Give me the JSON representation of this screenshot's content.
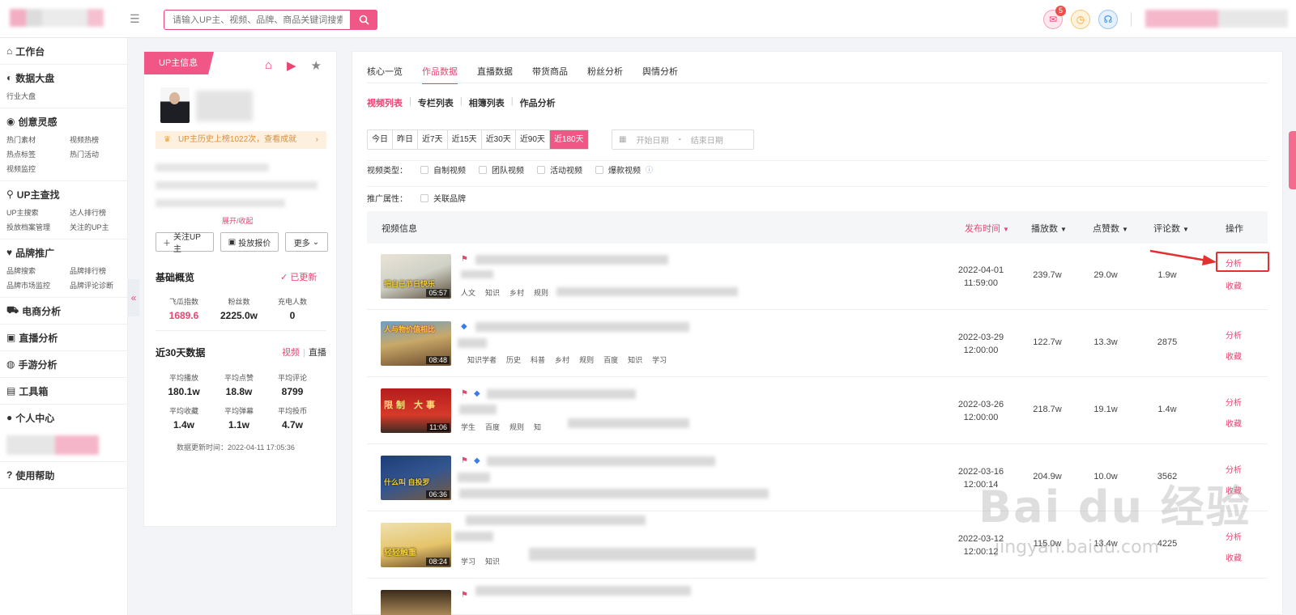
{
  "search": {
    "placeholder": "请输入UP主、视频、品牌、商品关键词搜索"
  },
  "notifications": {
    "mail_count": "5"
  },
  "sidebar": {
    "sections": [
      {
        "title": "工作台",
        "items": []
      },
      {
        "title": "数据大盘",
        "items": [
          "行业大盘"
        ]
      },
      {
        "title": "创意灵感",
        "items": [
          "热门素材",
          "视频热榜",
          "热点标签",
          "热门活动",
          "视频监控"
        ]
      },
      {
        "title": "UP主查找",
        "items": [
          "UP主搜索",
          "达人排行榜",
          "投放档案管理",
          "关注的UP主"
        ]
      },
      {
        "title": "品牌推广",
        "items": [
          "品牌搜索",
          "品牌排行榜",
          "品牌市场监控",
          "品牌评论诊断"
        ]
      },
      {
        "title": "电商分析",
        "items": []
      },
      {
        "title": "直播分析",
        "items": []
      },
      {
        "title": "手游分析",
        "items": []
      },
      {
        "title": "工具箱",
        "items": []
      },
      {
        "title": "个人中心",
        "items": []
      },
      {
        "title": "使用帮助",
        "items": []
      }
    ]
  },
  "up_panel": {
    "tag": "UP主信息",
    "notice": "UP主历史上榜1022次，查看成就",
    "expand": "展开/收起",
    "buttons": {
      "follow": "关注UP主",
      "quote": "投放报价",
      "more": "更多"
    },
    "overview_title": "基础概览",
    "updated": "已更新",
    "overview": [
      {
        "label": "飞瓜指数",
        "value": "1689.6"
      },
      {
        "label": "粉丝数",
        "value": "2225.0w"
      },
      {
        "label": "充电人数",
        "value": "0"
      }
    ],
    "recent_title": "近30天数据",
    "recent_tabs": {
      "video": "视频",
      "live": "直播"
    },
    "recent": [
      {
        "label": "平均播放",
        "value": "180.1w"
      },
      {
        "label": "平均点赞",
        "value": "18.8w"
      },
      {
        "label": "平均评论",
        "value": "8799"
      },
      {
        "label": "平均收藏",
        "value": "1.4w"
      },
      {
        "label": "平均弹幕",
        "value": "1.1w"
      },
      {
        "label": "平均投币",
        "value": "4.7w"
      }
    ],
    "update_time_label": "数据更新时间：",
    "update_time": "2022-04-11 17:05:36"
  },
  "main": {
    "tabs": [
      "核心一览",
      "作品数据",
      "直播数据",
      "带货商品",
      "粉丝分析",
      "舆情分析"
    ],
    "active_tab": 1,
    "subtabs": [
      "视频列表",
      "专栏列表",
      "相簿列表",
      "作品分析"
    ],
    "date_ranges": [
      "今日",
      "昨日",
      "近7天",
      "近15天",
      "近30天",
      "近90天",
      "近180天"
    ],
    "active_range": 6,
    "date_start_placeholder": "开始日期",
    "date_end_placeholder": "结束日期",
    "video_type_label": "视频类型：",
    "video_types": [
      "自制视频",
      "团队视频",
      "活动视频",
      "爆款视频"
    ],
    "promo_label": "推广属性：",
    "promo_types": [
      "关联品牌"
    ],
    "columns": {
      "info": "视频信息",
      "published": "发布时间",
      "plays": "播放数",
      "likes": "点赞数",
      "comments": "评论数",
      "ops": "操作"
    },
    "op_labels": {
      "analyze": "分析",
      "favorite": "收藏"
    },
    "rows": [
      {
        "date": "2022-04-01",
        "time": "11:59:00",
        "plays": "239.7w",
        "likes": "29.0w",
        "comments": "1.9w",
        "duration": "05:57",
        "thumb_text": "把自己节日快乐",
        "tags": [
          "人文",
          "知识",
          "乡村",
          "规则"
        ]
      },
      {
        "date": "2022-03-29",
        "time": "12:00:00",
        "plays": "122.7w",
        "likes": "13.3w",
        "comments": "2875",
        "duration": "08:48",
        "thumb_text": "人与物价值相比",
        "tags": [
          "知识学者",
          "历史",
          "科普",
          "乡村",
          "规则",
          "百度",
          "知识",
          "学习"
        ]
      },
      {
        "date": "2022-03-26",
        "time": "12:00:00",
        "plays": "218.7w",
        "likes": "19.1w",
        "comments": "1.4w",
        "duration": "11:06",
        "thumb_text": "限制 大事",
        "tags": [
          "学生",
          "百度",
          "规则",
          "知"
        ]
      },
      {
        "date": "2022-03-16",
        "time": "12:00:14",
        "plays": "204.9w",
        "likes": "10.0w",
        "comments": "3562",
        "duration": "06:36",
        "thumb_text": "什么叫 自投罗",
        "tags": []
      },
      {
        "date": "2022-03-12",
        "time": "12:00:12",
        "plays": "115.0w",
        "likes": "13.4w",
        "comments": "4225",
        "duration": "08:24",
        "thumb_text": "轻轻触重",
        "tags": [
          "学习",
          "知识"
        ]
      }
    ]
  },
  "watermark": {
    "brand": "Bai du 经验",
    "url": "jingyan.baidu.com"
  },
  "colors": {
    "accent": "#e84573",
    "accent_light": "#f05686",
    "highlight": "#e53030"
  }
}
